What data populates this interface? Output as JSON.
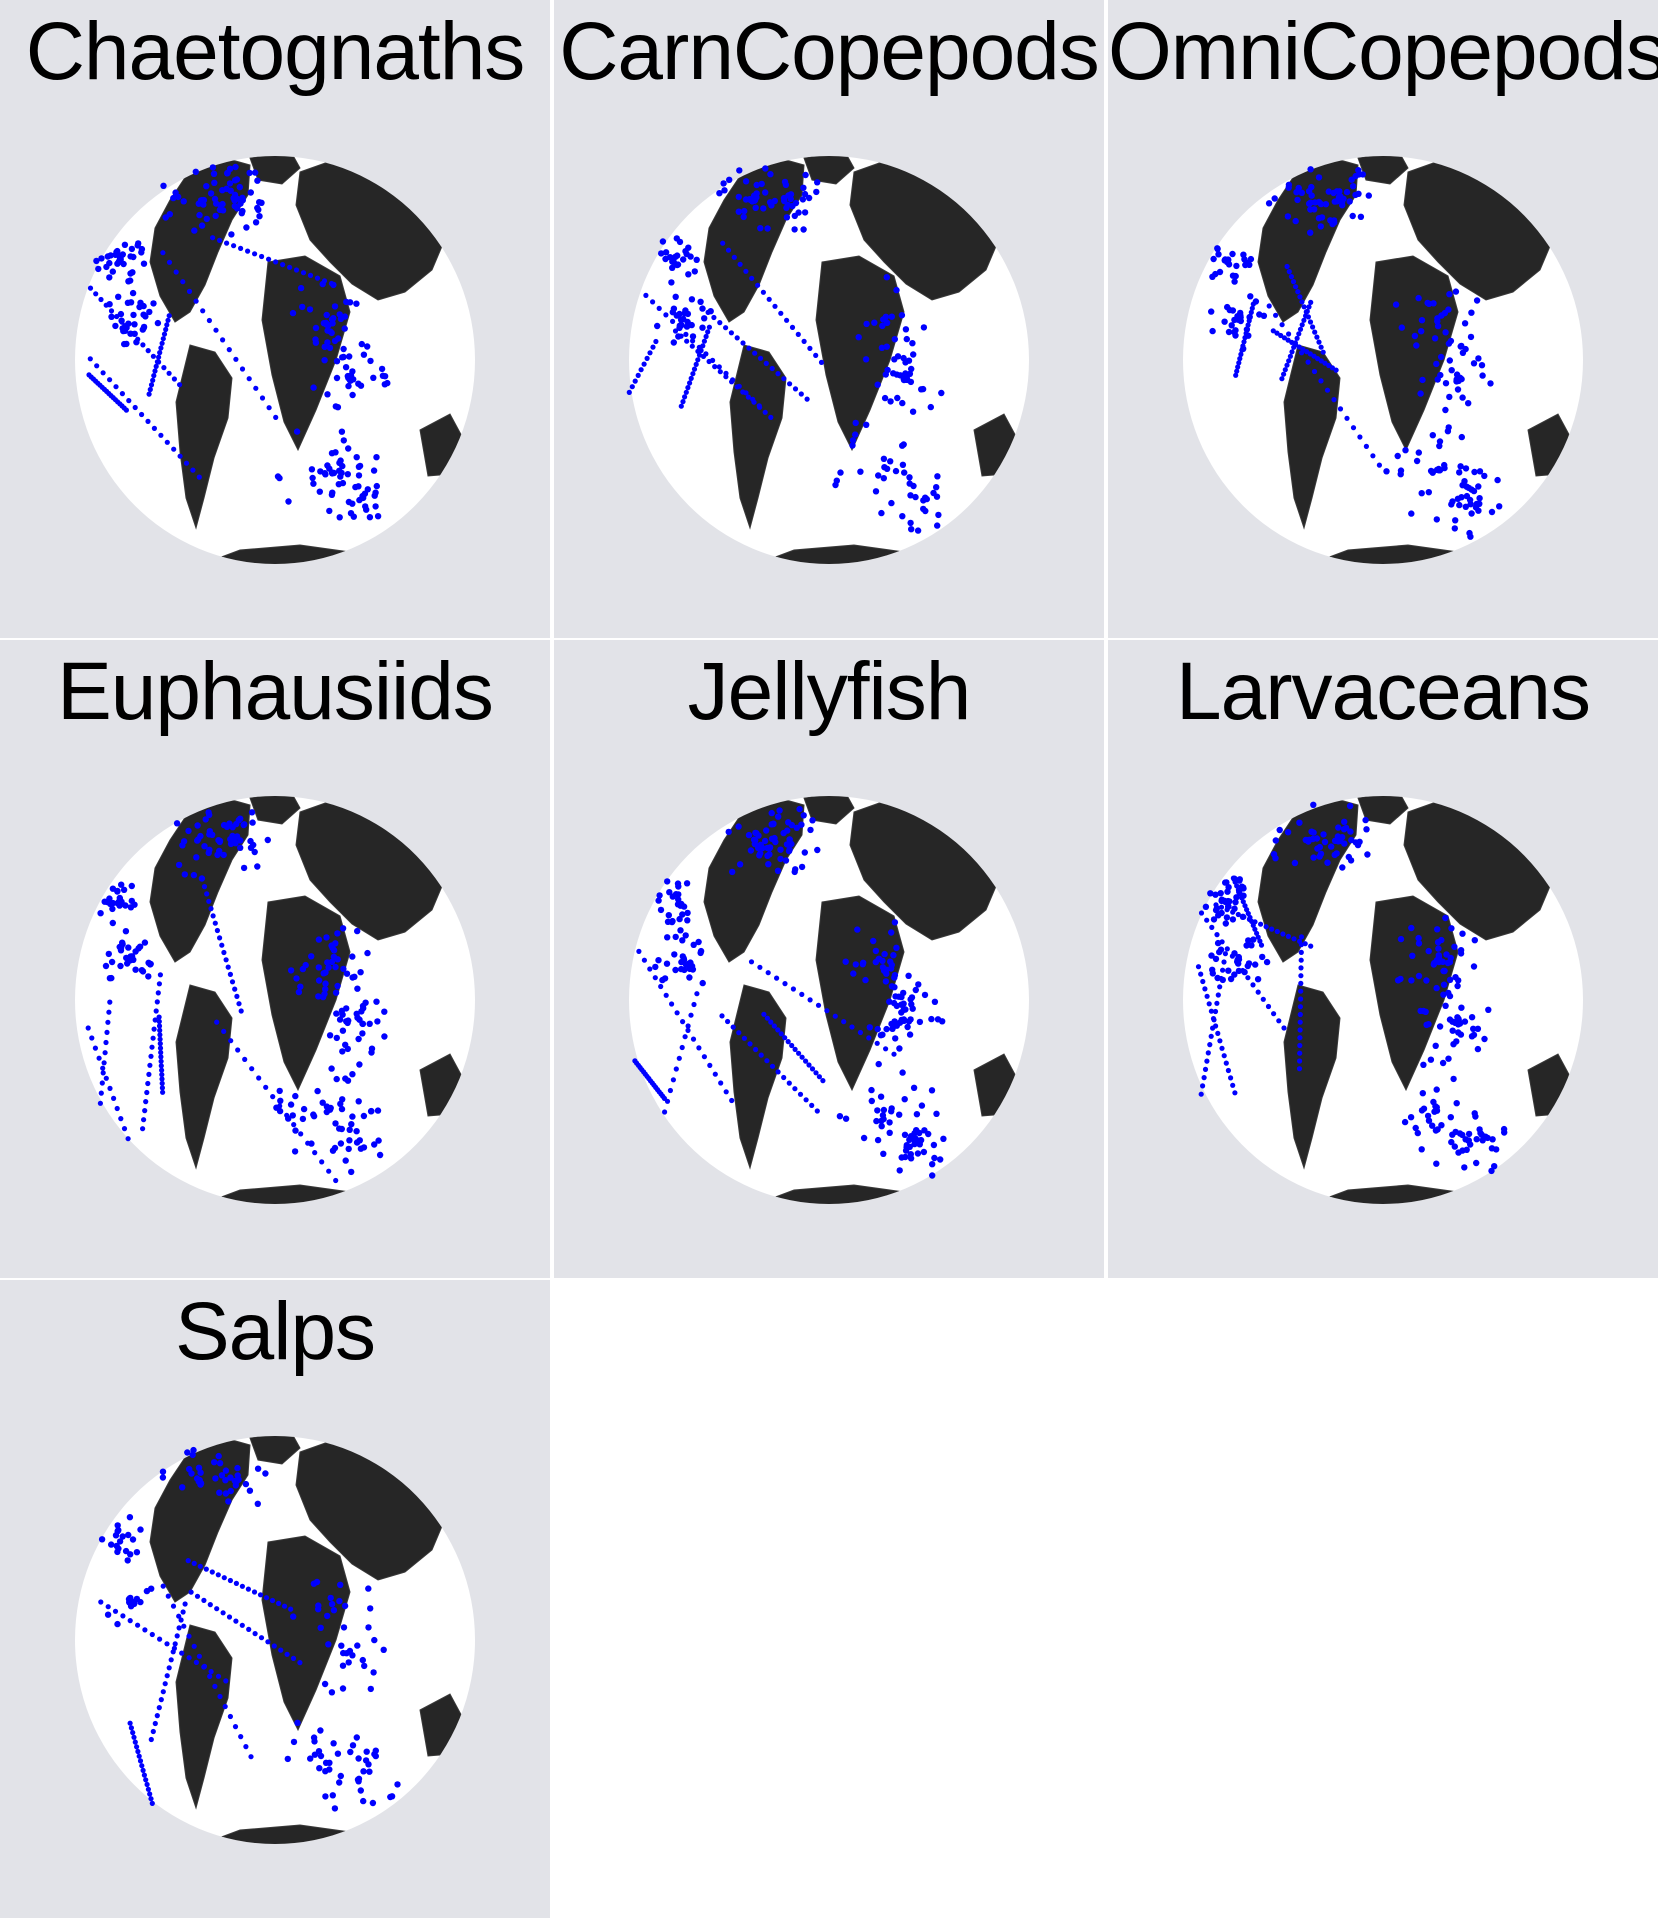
{
  "figure": {
    "background_color": "#e2e3e8",
    "land_color": "#262626",
    "ocean_color": "#ffffff",
    "point_color": "#0000ff",
    "panels": [
      {
        "title": "Chaetognaths"
      },
      {
        "title": "CarnCopepods"
      },
      {
        "title": "OmniCopepods"
      },
      {
        "title": "Euphausiids"
      },
      {
        "title": "Jellyfish"
      },
      {
        "title": "Larvaceans"
      },
      {
        "title": "Salps"
      }
    ]
  }
}
